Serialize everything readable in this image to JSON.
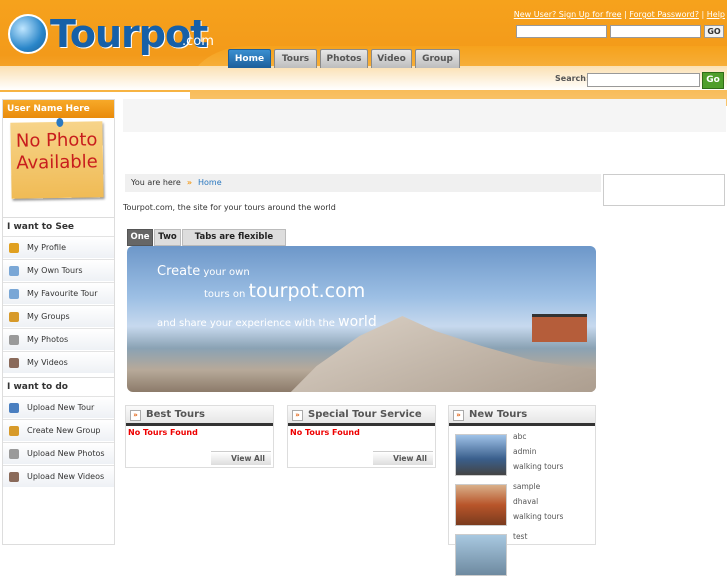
{
  "header": {
    "logo": "Tourpot",
    "logo_suffix": ".com",
    "links": {
      "signup": "New User? Sign Up for free",
      "forgot": "Forgot Password?",
      "help": "Help"
    },
    "login_go": "GO",
    "tabs": [
      "Home",
      "Tours",
      "Photos",
      "Video",
      "Group"
    ],
    "search_label": "Search:",
    "search_go": "Go"
  },
  "sidebar": {
    "username": "User Name Here",
    "nophoto_line1": "No Photo",
    "nophoto_line2": "Available",
    "section1": "I want to See",
    "see_items": [
      "My Profile",
      "My Own Tours",
      "My Favourite Tour",
      "My Groups",
      "My Photos",
      "My Videos"
    ],
    "section2": "I want to do",
    "do_items": [
      "Upload New Tour",
      "Create New Group",
      "Upload New Photos",
      "Upload New Videos"
    ]
  },
  "breadcrumb": {
    "you_are_here": "You are here",
    "arrow": "»",
    "home": "Home"
  },
  "intro": "Tourpot.com, the site for your tours around the world",
  "content_tabs": [
    "One",
    "Two",
    "Tabs are flexible again"
  ],
  "banner": {
    "create_big": "Create",
    "create_rest": " your own",
    "tours_on": "tours on ",
    "brand": "tourpot.com",
    "share": "and share your experience with the ",
    "world": "world"
  },
  "panels": {
    "best": {
      "title": "Best Tours",
      "empty": "No Tours Found",
      "view_all": "View All"
    },
    "special": {
      "title": "Special Tour Service",
      "empty": "No Tours Found",
      "view_all": "View All"
    },
    "new": {
      "title": "New Tours",
      "tours": [
        {
          "name": "abc",
          "user": "admin",
          "category": "walking tours"
        },
        {
          "name": "sample",
          "user": "dhaval",
          "category": "walking tours"
        },
        {
          "name": "test",
          "user": "",
          "category": ""
        }
      ]
    }
  },
  "colors": {
    "header_orange": "#f39a1a",
    "brand_blue": "#1660a8",
    "tab_active": "#1c5e9a",
    "go_green": "#4f9e2a",
    "not_found_red": "#e00000"
  }
}
